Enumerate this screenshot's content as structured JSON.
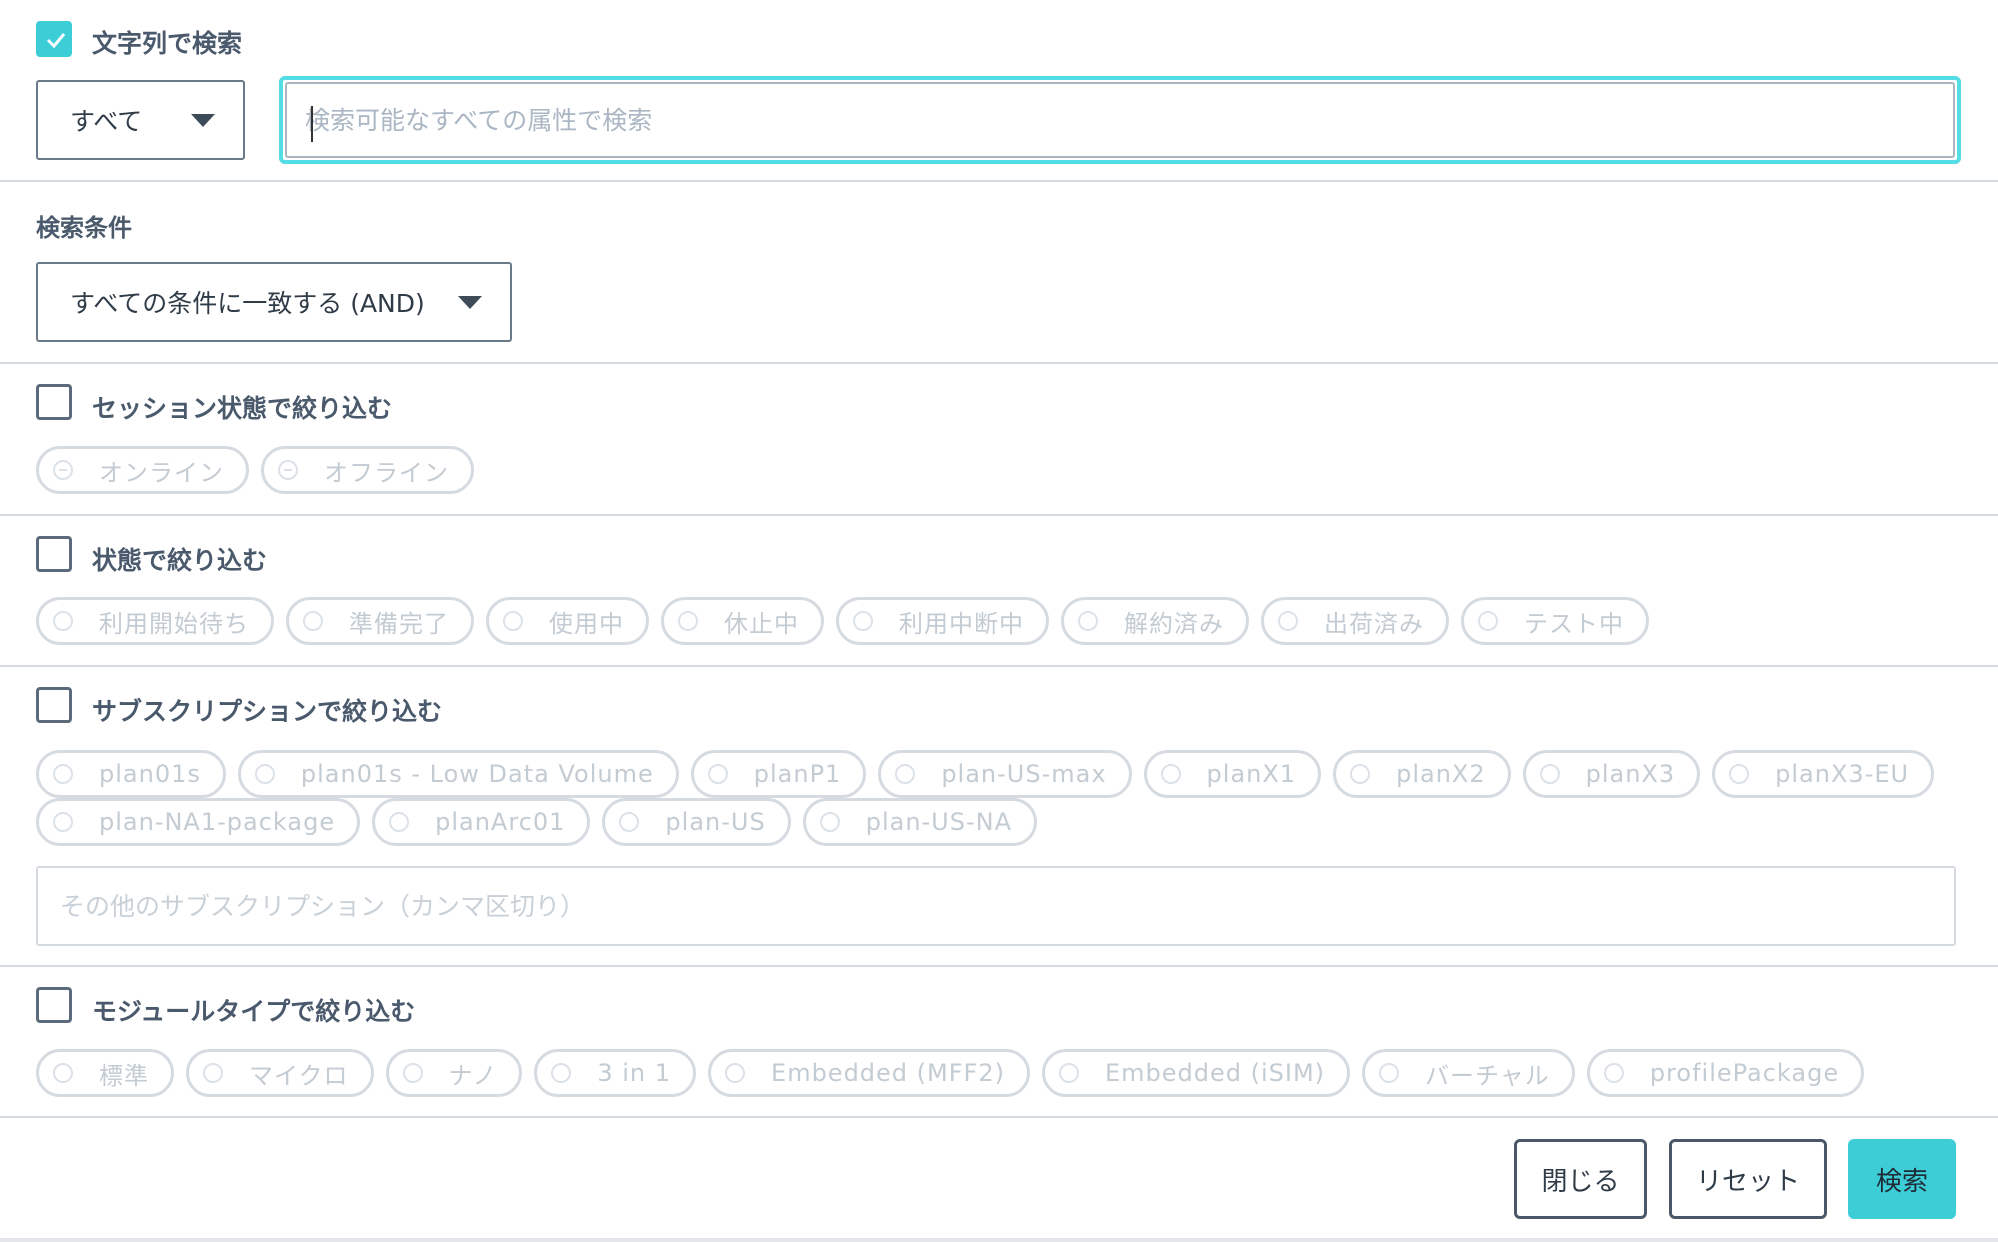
{
  "text_search": {
    "checkbox_label": "文字列で検索",
    "checked": true,
    "scope_select_value": "すべて",
    "search_placeholder": "検索可能なすべての属性で検索"
  },
  "search_condition": {
    "label": "検索条件",
    "select_value": "すべての条件に一致する (AND)"
  },
  "session_filter": {
    "checkbox_label": "セッション状態で絞り込む",
    "chips": [
      "オンライン",
      "オフライン"
    ]
  },
  "status_filter": {
    "checkbox_label": "状態で絞り込む",
    "chips": [
      "利用開始待ち",
      "準備完了",
      "使用中",
      "休止中",
      "利用中断中",
      "解約済み",
      "出荷済み",
      "テスト中"
    ]
  },
  "subscription_filter": {
    "checkbox_label": "サブスクリプションで絞り込む",
    "chips_row1": [
      "plan01s",
      "plan01s - Low Data Volume",
      "planP1",
      "plan-US-max",
      "planX1",
      "planX2",
      "planX3",
      "planX3-EU"
    ],
    "chips_row2": [
      "plan-NA1-package",
      "planArc01",
      "plan-US",
      "plan-US-NA"
    ],
    "other_placeholder": "その他のサブスクリプション（カンマ区切り）"
  },
  "module_filter": {
    "checkbox_label": "モジュールタイプで絞り込む",
    "chips": [
      "標準",
      "マイクロ",
      "ナノ",
      "3 in 1",
      "Embedded (MFF2)",
      "Embedded (iSIM)",
      "バーチャル",
      "profilePackage"
    ]
  },
  "footer": {
    "close_label": "閉じる",
    "reset_label": "リセット",
    "search_label": "検索"
  },
  "colors": {
    "accent": "#3ccdd6",
    "focus_ring": "#52dce6",
    "text": "#4a5a6c",
    "chip_border": "#d5dbe1"
  }
}
